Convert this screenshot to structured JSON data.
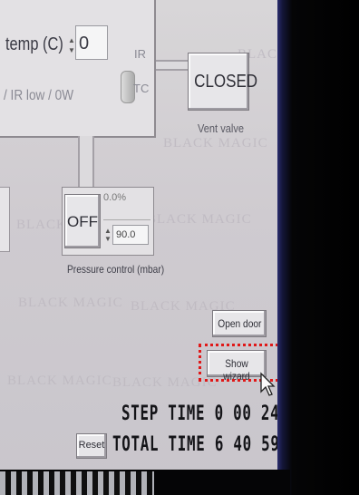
{
  "temperature": {
    "label": "temp (C)",
    "value": "0",
    "mode_note": "/ IR low / 0W",
    "toggle_labels": {
      "ir": "IR",
      "tc": "TC"
    }
  },
  "vent": {
    "state_label": "CLOSED",
    "caption": "Vent valve"
  },
  "pressure": {
    "button_label": "OFF",
    "readout": "0.0%",
    "setpoint": "90.0",
    "caption": "Pressure control (mbar)"
  },
  "actions": {
    "open_door": "Open door",
    "show_wizard": "Show wizard",
    "reset": "Reset"
  },
  "timers": {
    "step_time": "STEP TIME 0 00 24",
    "total_time": "TOTAL TIME 6 40 59"
  },
  "watermark_text": "BLACK MAGIC",
  "colors": {
    "highlight": "#e01818",
    "panel": "#e3e1e4"
  }
}
